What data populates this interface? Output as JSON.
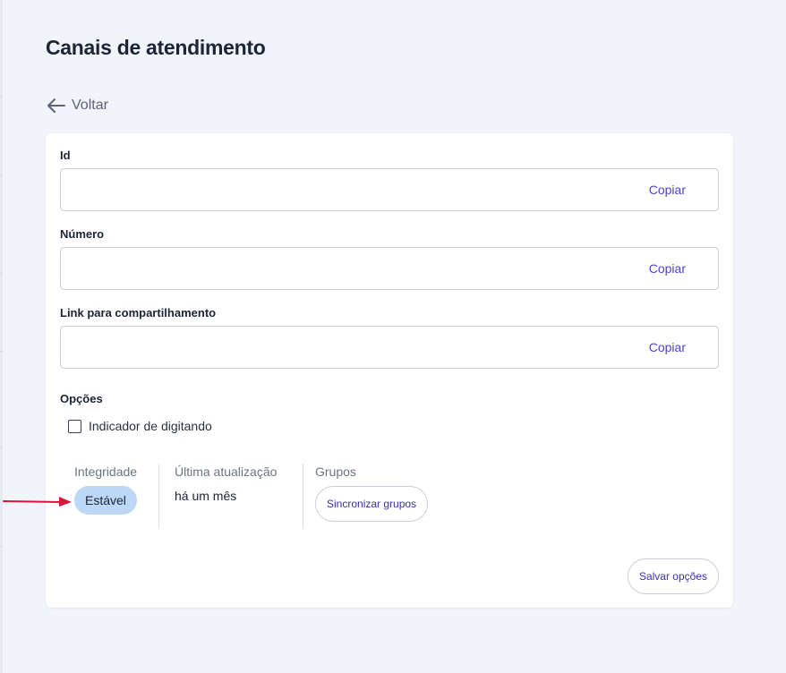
{
  "header": {
    "title": "Canais de atendimento"
  },
  "nav": {
    "back_label": "Voltar"
  },
  "form": {
    "fields": [
      {
        "label": "Id",
        "value": "",
        "copy_label": "Copiar"
      },
      {
        "label": "Número",
        "value": "",
        "copy_label": "Copiar"
      },
      {
        "label": "Link para compartilhamento",
        "value": "",
        "copy_label": "Copiar"
      }
    ],
    "options": {
      "title": "Opções",
      "typing_indicator": {
        "label": "Indicador de digitando",
        "checked": false
      }
    }
  },
  "status": {
    "integrity": {
      "title": "Integridade",
      "badge": "Estável",
      "badge_color": "#bcd8f6"
    },
    "last_update": {
      "title": "Última atualização",
      "value": "há um mês"
    },
    "groups": {
      "title": "Grupos",
      "sync_label": "Sincronizar grupos"
    }
  },
  "actions": {
    "save_label": "Salvar opções"
  },
  "colors": {
    "background": "#f1f4f9",
    "card": "#ffffff",
    "accent": "#4c3fd1",
    "annotation_arrow": "#e0123a"
  }
}
